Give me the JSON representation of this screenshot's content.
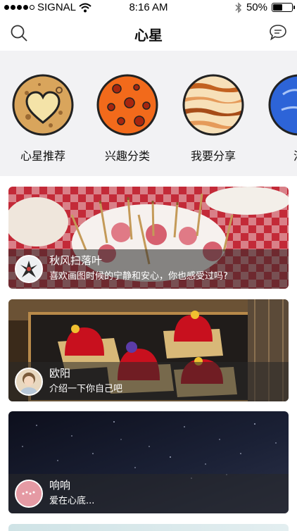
{
  "status_bar": {
    "carrier": "SIGNAL",
    "time": "8:16 AM",
    "battery_text": "50%",
    "battery_level": 0.5
  },
  "nav": {
    "title": "心星",
    "search_icon": "search-icon",
    "chat_icon": "chat-bubble-icon"
  },
  "categories": [
    {
      "label": "心星推荐",
      "icon": "heart-planet-icon",
      "color": "#d8a85a"
    },
    {
      "label": "兴趣分类",
      "icon": "spotted-planet-icon",
      "color": "#f26a1b"
    },
    {
      "label": "我要分享",
      "icon": "striped-planet-icon",
      "color": "#e8a766"
    },
    {
      "label": "活",
      "icon": "blue-planet-icon",
      "color": "#2d64d8"
    }
  ],
  "feed": [
    {
      "name": "秋风扫落叶",
      "desc": "喜欢画图时候的宁静和安心，你也感受过吗?"
    },
    {
      "name": "欧阳",
      "desc": "介绍一下你自己吧"
    },
    {
      "name": "响响",
      "desc": "爱在心底..."
    }
  ]
}
